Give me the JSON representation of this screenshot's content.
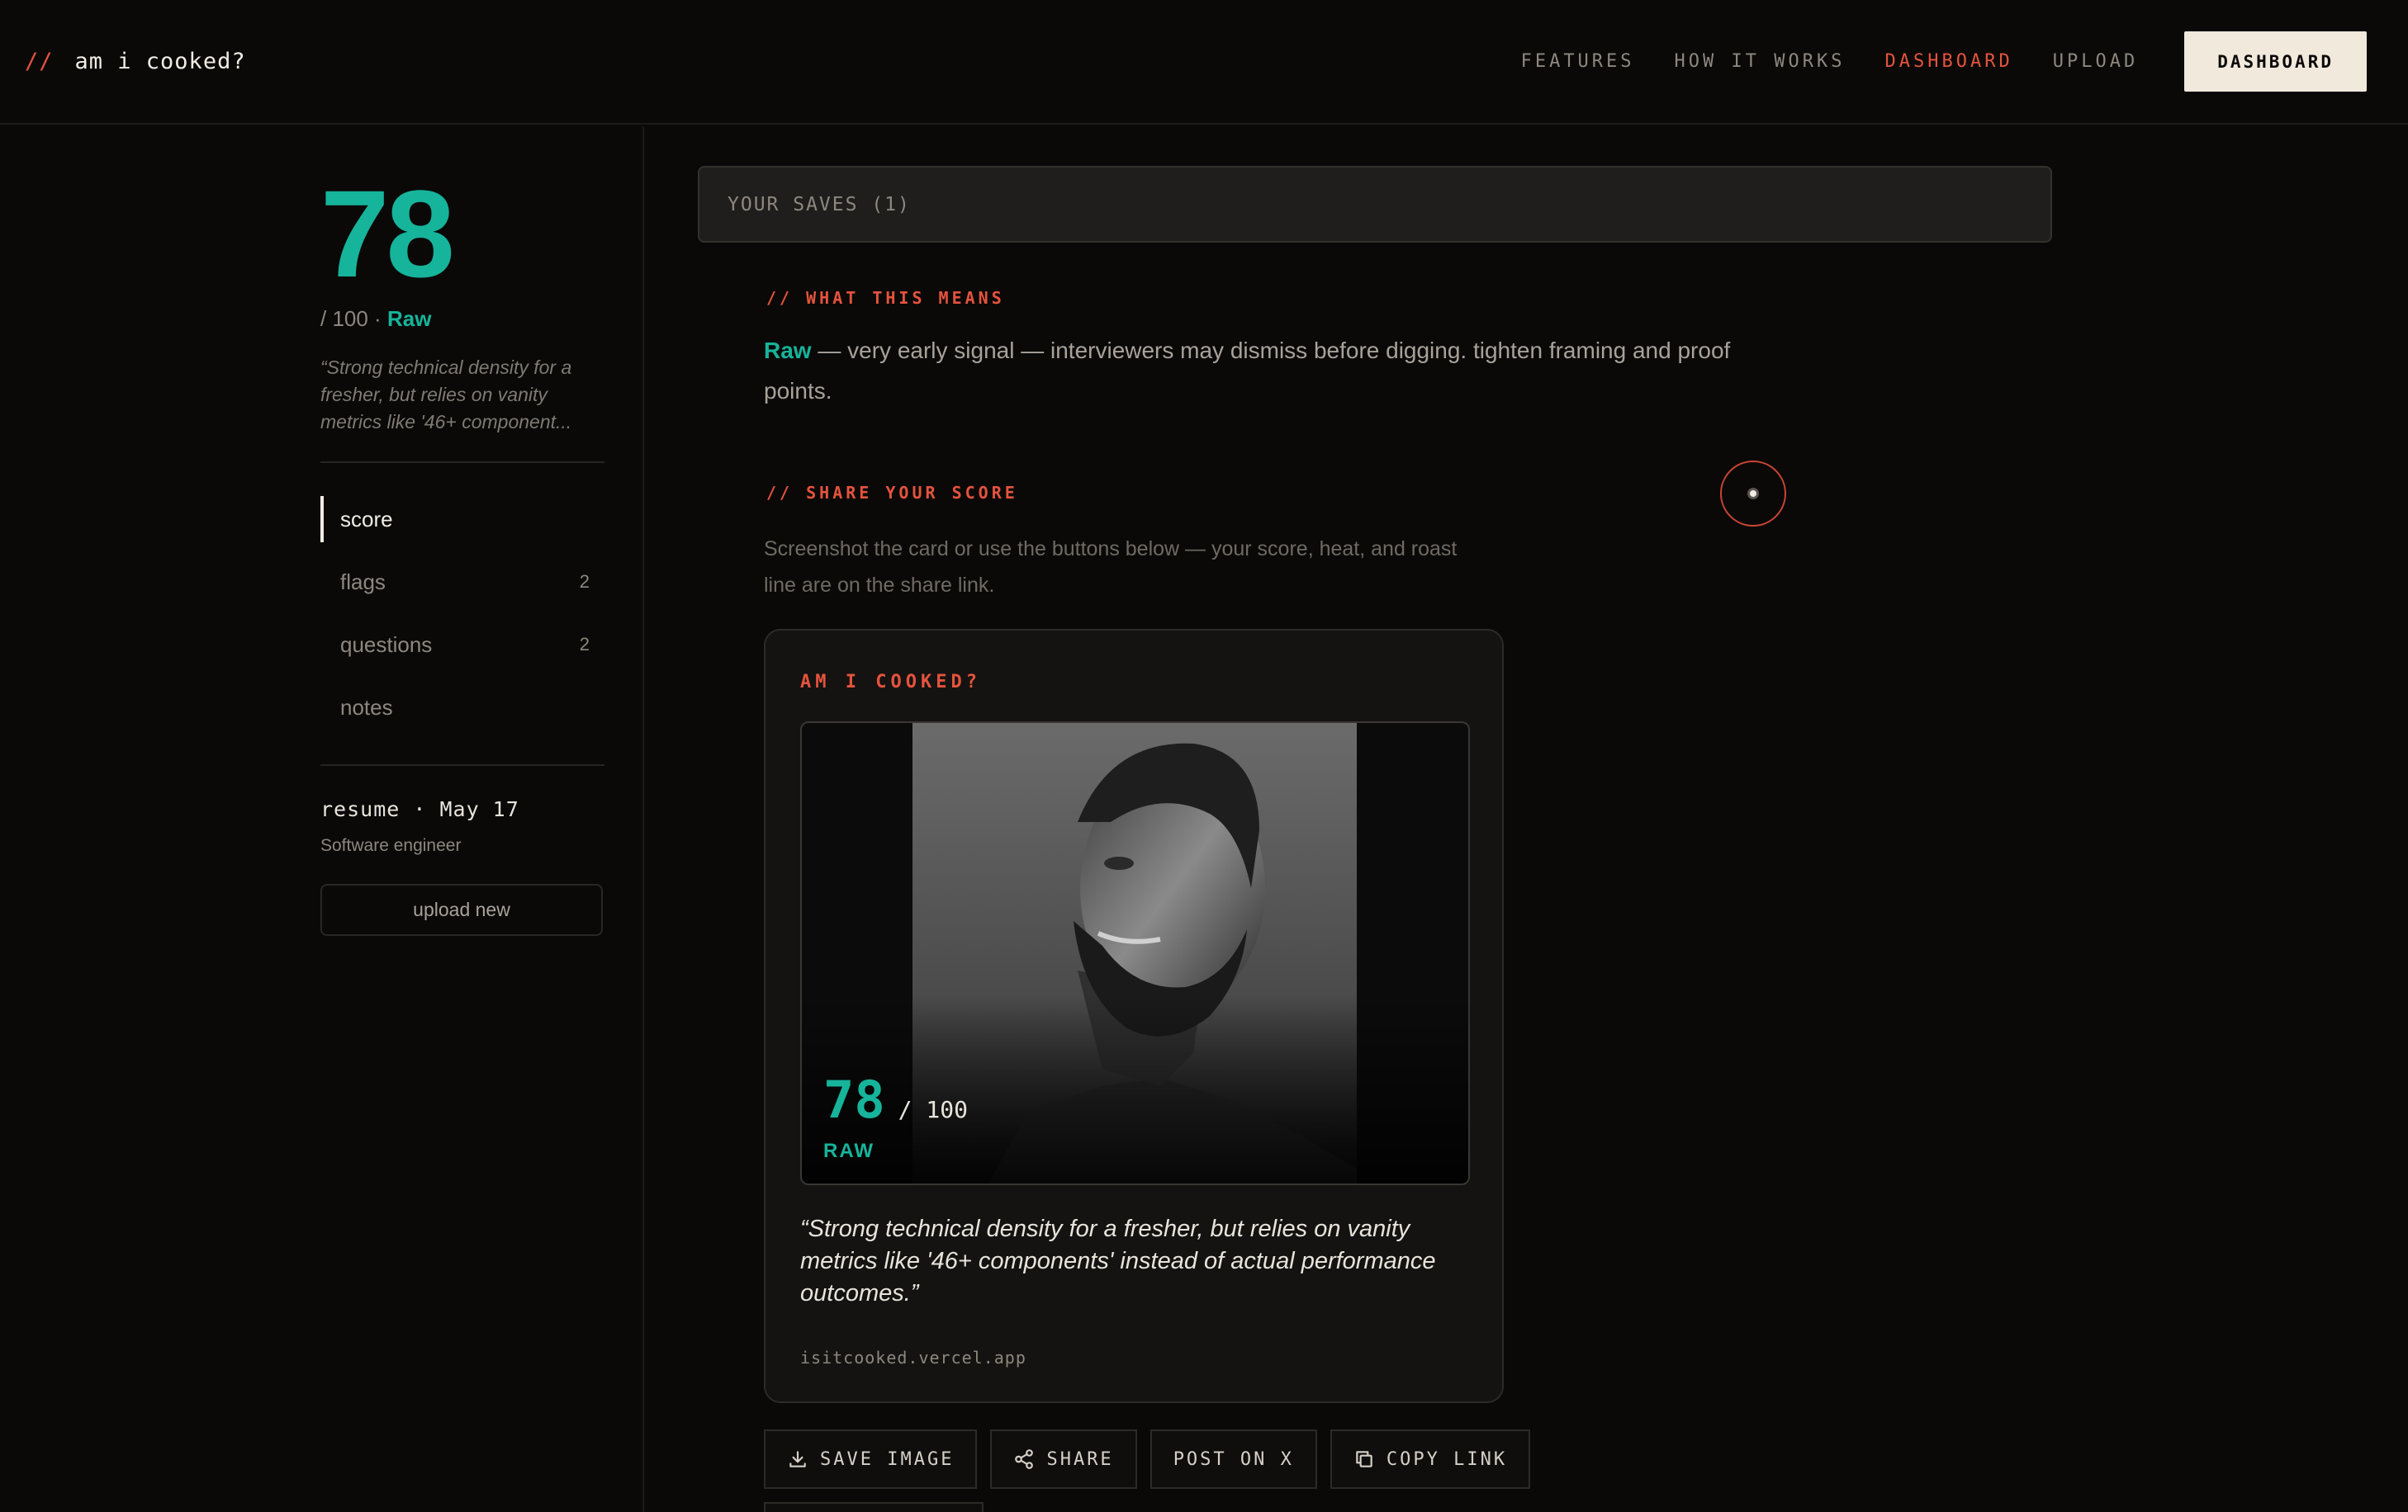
{
  "nav": {
    "brand_slashes": "//",
    "brand_name": "am i cooked?",
    "links": [
      "FEATURES",
      "HOW IT WORKS",
      "DASHBOARD",
      "UPLOAD"
    ],
    "cta": "DASHBOARD",
    "active_link": "DASHBOARD"
  },
  "sidebar": {
    "score": "78",
    "score_suffix": "/ 100 ·",
    "tier": "Raw",
    "quote": "“Strong technical density for a fresher, but relies on vanity metrics like '46+ component...",
    "items": [
      {
        "label": "score",
        "count": ""
      },
      {
        "label": "flags",
        "count": "2"
      },
      {
        "label": "questions",
        "count": "2"
      },
      {
        "label": "notes",
        "count": ""
      }
    ],
    "resume_line": "resume · May 17",
    "resume_role": "Software engineer",
    "upload_label": "upload new"
  },
  "main": {
    "saves_label": "YOUR SAVES (1)",
    "means_label": "//  WHAT THIS MEANS",
    "means_tier": "Raw",
    "means_text": " — very early signal — interviewers may dismiss before digging. tighten framing and proof points.",
    "share_label": "//  SHARE YOUR SCORE",
    "share_desc": "Screenshot the card or use the buttons below — your score, heat, and roast line are on the share link."
  },
  "card": {
    "title": "AM I COOKED?",
    "score": "78",
    "score_denom": "/ 100",
    "tier": "RAW",
    "quote": "“Strong technical density for a fresher, but relies on vanity metrics like '46+ components' instead of actual performance outcomes.”",
    "url": "isitcooked.vercel.app"
  },
  "actions": {
    "save_image": "SAVE IMAGE",
    "share": "SHARE",
    "post_x": "POST ON X",
    "copy_link": "COPY LINK"
  },
  "colors": {
    "accent_teal": "#16b49b",
    "accent_red": "#e5533d",
    "background": "#0a0908"
  },
  "icons": [
    "download-icon",
    "share-icon",
    "copy-icon"
  ]
}
